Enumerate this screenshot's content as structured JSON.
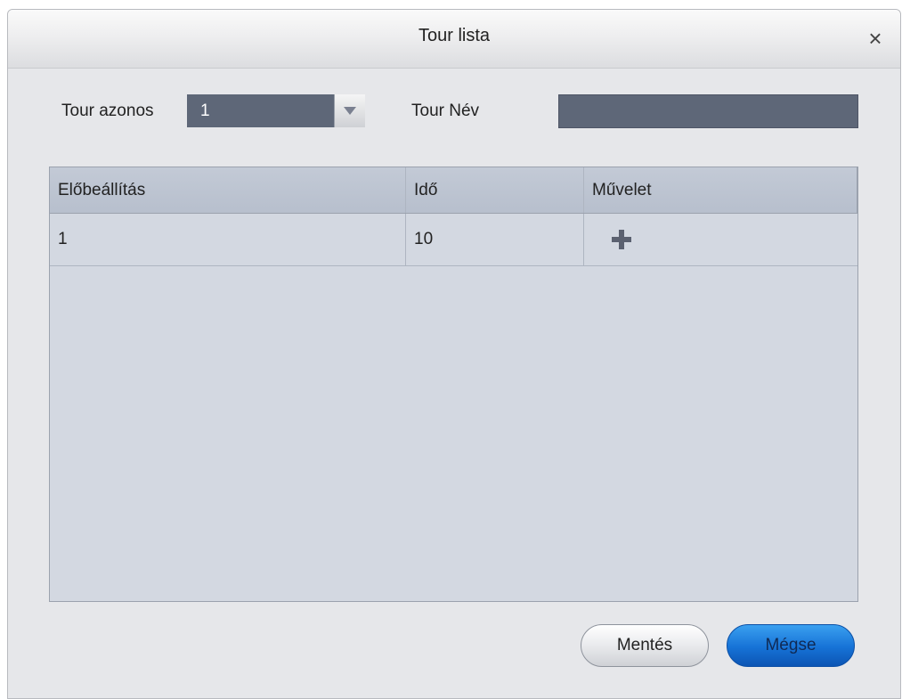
{
  "dialog": {
    "title": "Tour lista",
    "close_glyph": "×",
    "close_icon": "close-icon"
  },
  "form": {
    "tour_id_label": "Tour azonos",
    "tour_id_value": "1",
    "tour_name_label": "Tour Név",
    "tour_name_value": ""
  },
  "table": {
    "columns": [
      "Előbeállítás",
      "Idő",
      "Művelet"
    ],
    "rows": [
      {
        "preset": "1",
        "time": "10",
        "action_icon": "plus-icon"
      }
    ]
  },
  "buttons": {
    "save_label": "Mentés",
    "cancel_label": "Mégse"
  },
  "colors": {
    "field_bg": "#5e6778",
    "table_bg": "#d3d8e1",
    "header_bg": "#b7bfcd",
    "primary_button": "#1672d6"
  }
}
